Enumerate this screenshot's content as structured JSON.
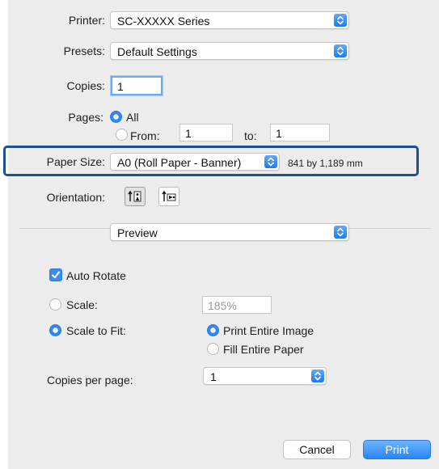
{
  "printer": {
    "label": "Printer:",
    "value": "SC-XXXXX Series"
  },
  "presets": {
    "label": "Presets:",
    "value": "Default Settings"
  },
  "copies": {
    "label": "Copies:",
    "value": "1"
  },
  "pages": {
    "label": "Pages:",
    "all_label": "All",
    "from_label": "From:",
    "from_value": "1",
    "to_label": "to:",
    "to_value": "1",
    "selected": "All"
  },
  "paper_size": {
    "label": "Paper Size:",
    "value": "A0 (Roll Paper - Banner)",
    "dimensions": "841 by 1,189 mm"
  },
  "orientation": {
    "label": "Orientation:",
    "selected": "portrait"
  },
  "section_popup": {
    "value": "Preview"
  },
  "preview": {
    "auto_rotate_label": "Auto Rotate",
    "auto_rotate_checked": true,
    "scale_label": "Scale:",
    "scale_value": "185%",
    "scale_to_fit_label": "Scale to Fit:",
    "scale_mode": "Scale to Fit",
    "print_entire_image_label": "Print Entire Image",
    "fill_entire_paper_label": "Fill Entire Paper",
    "fit_mode": "Print Entire Image",
    "copies_per_page_label": "Copies per page:",
    "copies_per_page_value": "1"
  },
  "buttons": {
    "cancel": "Cancel",
    "print": "Print"
  },
  "colors": {
    "accent": "#2f86f0",
    "highlight_border": "#1e4f8f",
    "panel_bg": "#ececec"
  }
}
